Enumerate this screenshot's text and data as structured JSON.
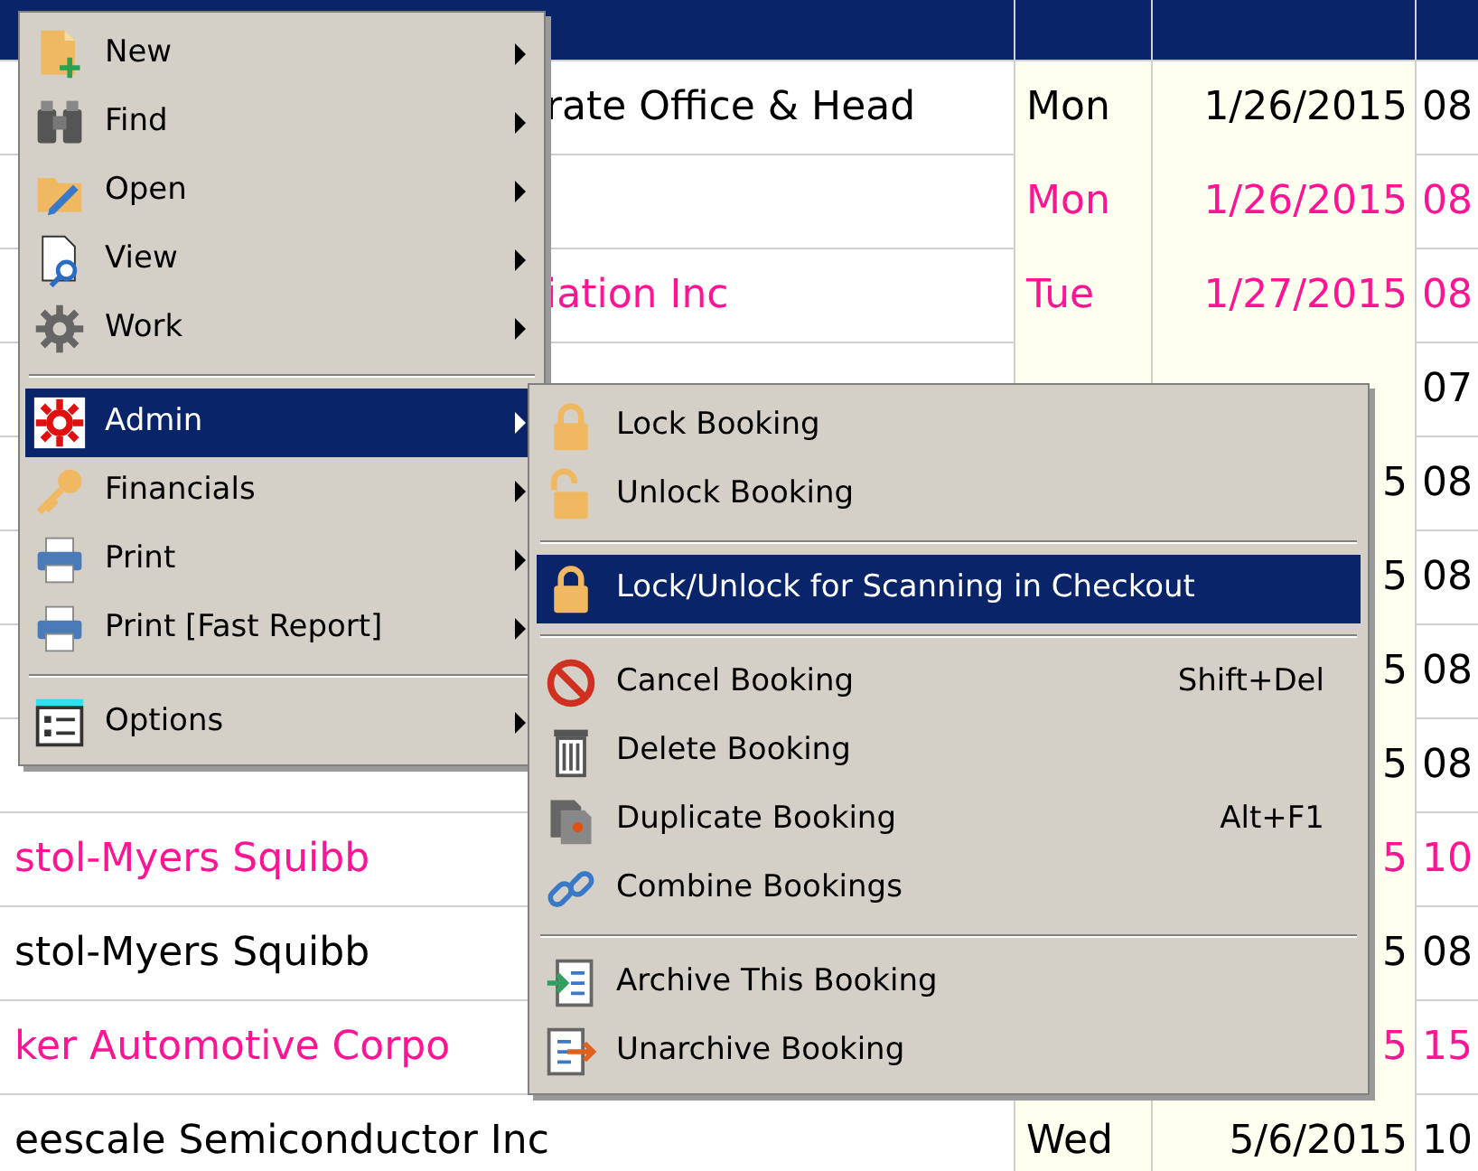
{
  "table": {
    "rows": [
      {
        "selected": true
      },
      {
        "name": "rate Office & Head",
        "day": "Mon",
        "date": "1/26/2015",
        "time": "08",
        "selected": false,
        "color": "#000000"
      },
      {
        "day": "Mon",
        "date": "1/26/2015",
        "time": "08",
        "selected": false,
        "color": "#ff1493"
      },
      {
        "name": "iation Inc",
        "day": "Tue",
        "date": "1/27/2015",
        "time": "08",
        "selected": false,
        "color": "#ff1493"
      },
      {
        "time": "07",
        "selected": false,
        "color": "#000000"
      },
      {
        "date": "5",
        "time": "08",
        "selected": false,
        "color": "#000000"
      },
      {
        "date": "5",
        "time": "08",
        "selected": false,
        "color": "#000000"
      },
      {
        "date": "5",
        "time": "08",
        "selected": false,
        "color": "#000000"
      },
      {
        "date": "5",
        "time": "08",
        "selected": false,
        "color": "#000000"
      },
      {
        "name": "stol-Myers Squibb",
        "date": "5",
        "time": "10",
        "selected": false,
        "color": "#ff1493"
      },
      {
        "name": "stol-Myers Squibb",
        "date": "5",
        "time": "08",
        "selected": false,
        "color": "#000000"
      },
      {
        "name": "ker Automotive Corpo",
        "date": "5",
        "time": "15",
        "selected": false,
        "color": "#ff1493"
      },
      {
        "name": "eescale Semiconductor Inc",
        "day": "Wed",
        "date": "5/6/2015",
        "time": "10",
        "selected": false,
        "color": "#000000"
      }
    ]
  },
  "context_menu": {
    "items": [
      {
        "kind": "item",
        "label": "New",
        "has_submenu": true,
        "selected": false
      },
      {
        "kind": "item",
        "label": "Find",
        "has_submenu": true,
        "selected": false
      },
      {
        "kind": "item",
        "label": "Open",
        "has_submenu": true,
        "selected": false
      },
      {
        "kind": "item",
        "label": "View",
        "has_submenu": true,
        "selected": false
      },
      {
        "kind": "item",
        "label": "Work",
        "has_submenu": true,
        "selected": false
      },
      {
        "kind": "separator"
      },
      {
        "kind": "item",
        "label": "Admin",
        "has_submenu": true,
        "selected": true
      },
      {
        "kind": "item",
        "label": "Financials",
        "has_submenu": true,
        "selected": false
      },
      {
        "kind": "item",
        "label": "Print",
        "has_submenu": true,
        "selected": false
      },
      {
        "kind": "item",
        "label": "Print [Fast Report]",
        "has_submenu": true,
        "selected": false
      },
      {
        "kind": "separator"
      },
      {
        "kind": "item",
        "label": "Options",
        "has_submenu": true,
        "selected": false
      }
    ]
  },
  "admin_submenu": {
    "items": [
      {
        "kind": "item",
        "label": "Lock Booking",
        "selected": false
      },
      {
        "kind": "item",
        "label": "Unlock Booking",
        "selected": false
      },
      {
        "kind": "separator"
      },
      {
        "kind": "item",
        "label": "Lock/Unlock for Scanning in Checkout",
        "selected": true
      },
      {
        "kind": "separator"
      },
      {
        "kind": "item",
        "label": "Cancel Booking",
        "shortcut": "Shift+Del",
        "selected": false
      },
      {
        "kind": "item",
        "label": "Delete Booking",
        "selected": false
      },
      {
        "kind": "item",
        "label": "Duplicate Booking",
        "shortcut": "Alt+F1",
        "selected": false
      },
      {
        "kind": "item",
        "label": "Combine Bookings",
        "selected": false
      },
      {
        "kind": "separator"
      },
      {
        "kind": "item",
        "label": "Archive This Booking",
        "selected": false
      },
      {
        "kind": "item",
        "label": "Unarchive Booking",
        "selected": false
      }
    ]
  }
}
